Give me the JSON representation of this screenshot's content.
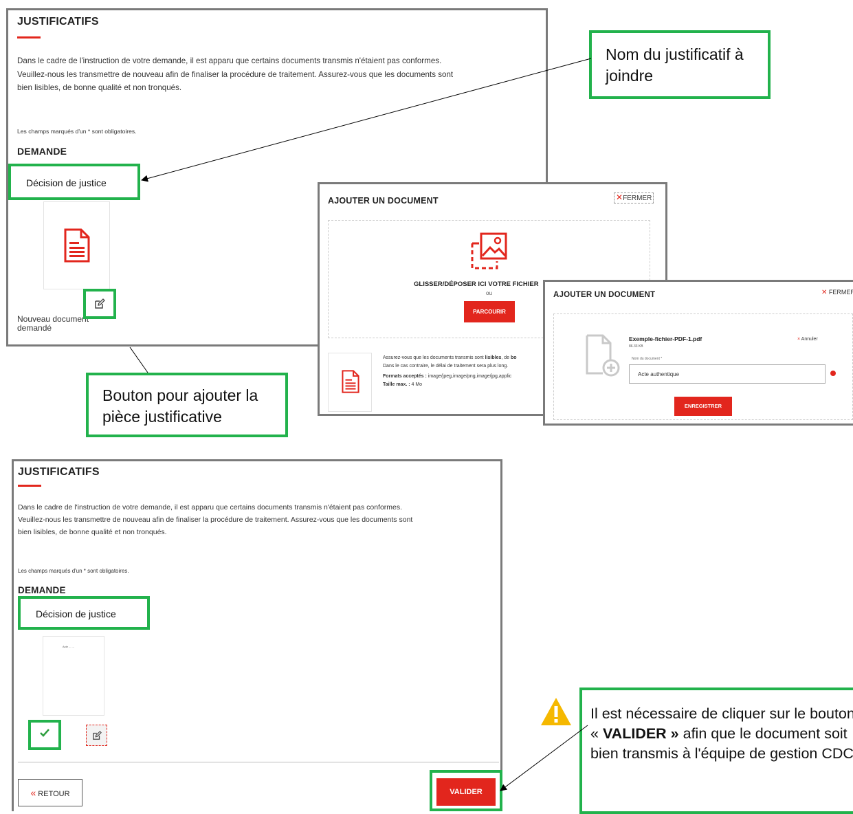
{
  "justificatifs": {
    "title": "JUSTIFICATIFS",
    "intro_line1": "Dans le cadre de l'instruction de votre demande, il est apparu que certains documents transmis n'étaient pas conformes.",
    "intro_line2": "Veuillez-nous les transmettre de nouveau afin de finaliser la procédure de traitement. Assurez-vous que les documents sont",
    "intro_line3": "bien lisibles, de bonne qualité et non tronqués.",
    "required_note": "Les champs marqués d'un * sont obligatoires.",
    "section": "DEMANDE",
    "doc_label": "Décision de justice",
    "new_doc_label_1": "Nouveau document",
    "new_doc_label_2": "demandé"
  },
  "callouts": {
    "nom_justificatif": "Nom du justificatif à joindre",
    "bouton_ajouter": "Bouton pour ajouter la pièce justificative",
    "valider_before": "Il est nécessaire de cliquer sur le bouton « ",
    "valider_strong": "VALIDER »",
    "valider_after": " afin que le document soit bien transmis à l'équipe de gestion CDC."
  },
  "modal1": {
    "title": "AJOUTER UN DOCUMENT",
    "close": "FERMER",
    "drop_text": "GLISSER/DÉPOSER ICI VOTRE FICHIER",
    "or": "ou",
    "browse": "PARCOURIR",
    "info_prefix": "Assurez-vous que les documents transmis sont ",
    "info_strong1": "lisibles",
    "info_mid": ", de ",
    "info_strong2": "bo",
    "info_line2": "Dans le cas contraire, le délai de traitement sera plus long.",
    "formats_label": "Formats acceptés :",
    "formats_value": " image/jpeg,image/png,image/jpg,applic",
    "max_label": "Taille max. :",
    "max_value": " 4 Mo"
  },
  "modal2": {
    "title": "AJOUTER UN DOCUMENT",
    "close": "FERMER",
    "filename": "Exemple-fichier-PDF-1.pdf",
    "filesize": "86.33 KB",
    "cancel": "Annuler",
    "field_label": "Nom du document *",
    "field_value": "Acte authentique",
    "save": "ENREGISTRER"
  },
  "bottom": {
    "title": "JUSTIFICATIFS",
    "intro_line1": "Dans le cadre de l'instruction de votre demande, il est apparu que certains documents transmis n'étaient pas conformes.",
    "intro_line2": "Veuillez-nous les transmettre de nouveau afin de finaliser la procédure de traitement. Assurez-vous que les documents sont",
    "intro_line3": "bien lisibles, de bonne qualité et non tronqués.",
    "required_note": "Les champs marqués d'un * sont obligatoires.",
    "section": "DEMANDE",
    "doc_label": "Décision de justice",
    "thumb_text": "Acte ... ...",
    "back": "RETOUR",
    "validate": "VALIDER"
  },
  "colors": {
    "accent_red": "#e2261d",
    "callout_green": "#22b24c",
    "frame_grey": "#7a7a7a",
    "warning_yellow": "#f5b800"
  },
  "icons": [
    "document-icon",
    "edit-icon",
    "image-upload-icon",
    "file-add-icon",
    "check-icon",
    "warning-icon",
    "close-icon",
    "double-chevron-left-icon",
    "error-icon"
  ]
}
